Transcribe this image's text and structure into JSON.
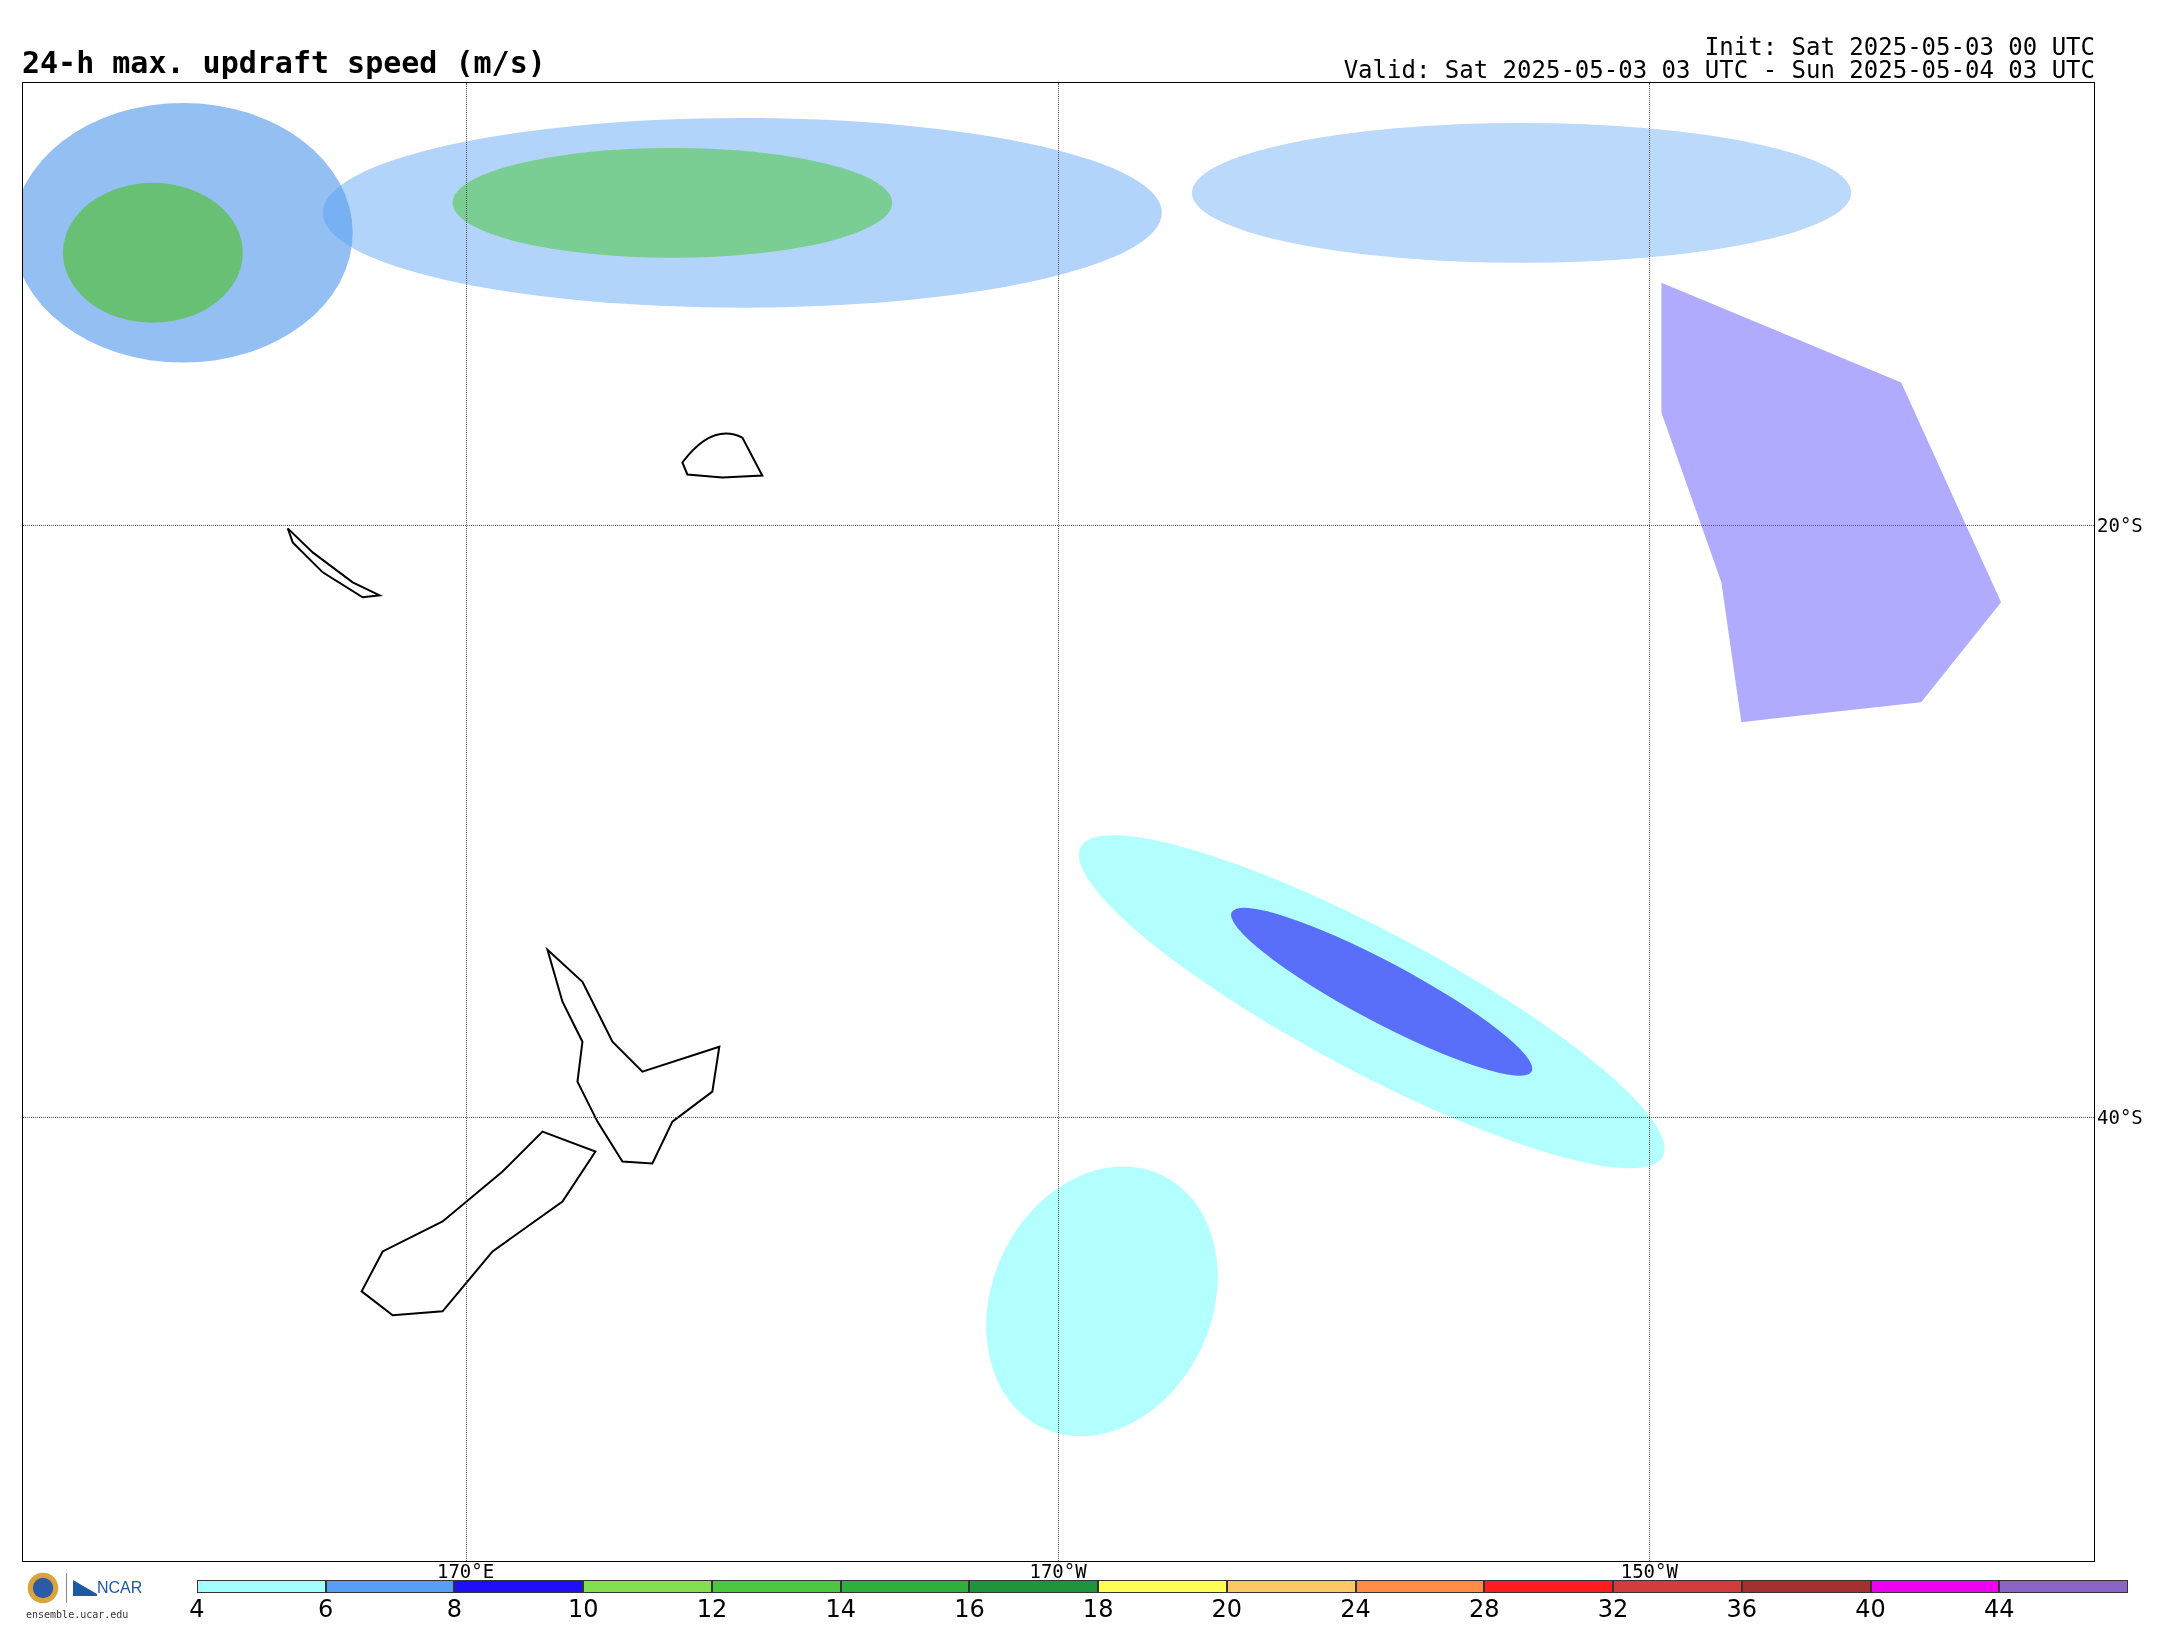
{
  "title": "24-h max. updraft speed (m/s)",
  "init": "Init: Sat 2025-05-03 00 UTC",
  "valid": "Valid: Sat 2025-05-03 03 UTC - Sun 2025-05-04 03 UTC",
  "map": {
    "lat_labels": [
      "20°S",
      "40°S"
    ],
    "lon_labels": [
      "170°E",
      "170°W",
      "150°W"
    ]
  },
  "logos": {
    "ncar": "NCAR",
    "site": "ensemble.ucar.edu"
  },
  "colorbar": [
    {
      "label": "4",
      "color": "#a0ffff"
    },
    {
      "label": "6",
      "color": "#55a0f5"
    },
    {
      "label": "8",
      "color": "#1e0ff5"
    },
    {
      "label": "10",
      "color": "#80e050"
    },
    {
      "label": "12",
      "color": "#4cc840"
    },
    {
      "label": "14",
      "color": "#2fb03a"
    },
    {
      "label": "16",
      "color": "#1f943a"
    },
    {
      "label": "18",
      "color": "#ffff55"
    },
    {
      "label": "20",
      "color": "#ffc864"
    },
    {
      "label": "24",
      "color": "#ff8c46"
    },
    {
      "label": "28",
      "color": "#ff1e1e"
    },
    {
      "label": "32",
      "color": "#d23c3c"
    },
    {
      "label": "36",
      "color": "#a53030"
    },
    {
      "label": "40",
      "color": "#f000f0"
    },
    {
      "label": "44",
      "color": "#8c64c8"
    }
  ]
}
